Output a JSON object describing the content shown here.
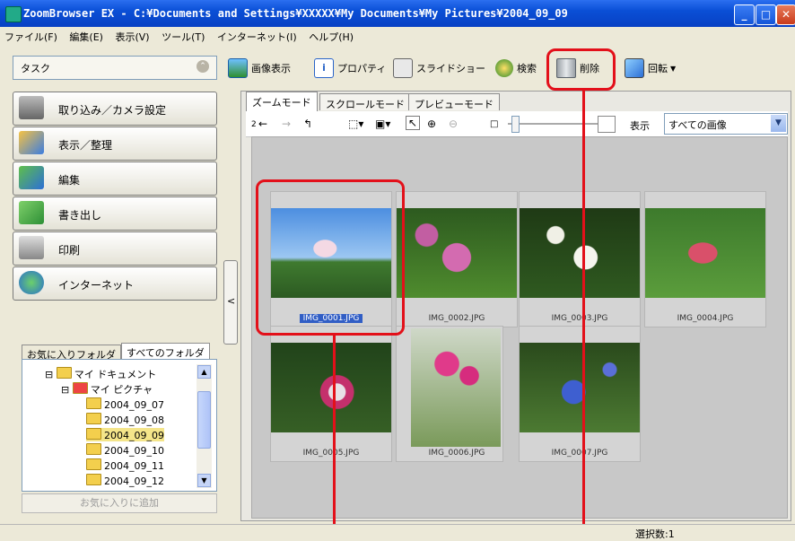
{
  "window": {
    "title": "ZoomBrowser EX  -  C:¥Documents and Settings¥XXXXX¥My Documents¥My Pictures¥2004_09_09"
  },
  "menu": [
    "ファイル(F)",
    "編集(E)",
    "表示(V)",
    "ツール(T)",
    "インターネット(I)",
    "ヘルプ(H)"
  ],
  "task_header": "タスク",
  "tasks": [
    "取り込み／カメラ設定",
    "表示／整理",
    "編集",
    "書き出し",
    "印刷",
    "インターネット"
  ],
  "toolbar": {
    "view_image": "画像表示",
    "properties": "プロパティ",
    "slideshow": "スライドショー",
    "search": "検索",
    "delete": "削除",
    "rotate": "回転"
  },
  "view_tabs": [
    "ズームモード",
    "スクロールモード",
    "プレビューモード"
  ],
  "view_tools": {
    "display_label": "表示",
    "display_value": "すべての画像"
  },
  "thumbnails": [
    {
      "name": "IMG_0001.JPG",
      "selected": true
    },
    {
      "name": "IMG_0002.JPG"
    },
    {
      "name": "IMG_0003.JPG"
    },
    {
      "name": "IMG_0004.JPG"
    },
    {
      "name": "IMG_0005.JPG"
    },
    {
      "name": "IMG_0006.JPG"
    },
    {
      "name": "IMG_0007.JPG"
    }
  ],
  "folder_tabs": [
    "お気に入りフォルダ",
    "すべてのフォルダ"
  ],
  "tree": {
    "my_documents": "マイ ドキュメント",
    "my_pictures": "マイ ピクチャ",
    "folders": [
      "2004_09_07",
      "2004_09_08",
      "2004_09_09",
      "2004_09_10",
      "2004_09_11",
      "2004_09_12"
    ]
  },
  "add_favorite": "お気に入りに追加",
  "status": "選択数:1",
  "colors": {
    "highlight": "#e3101a",
    "title_bar": "#0a4fd6",
    "selection": "#315ec5"
  }
}
